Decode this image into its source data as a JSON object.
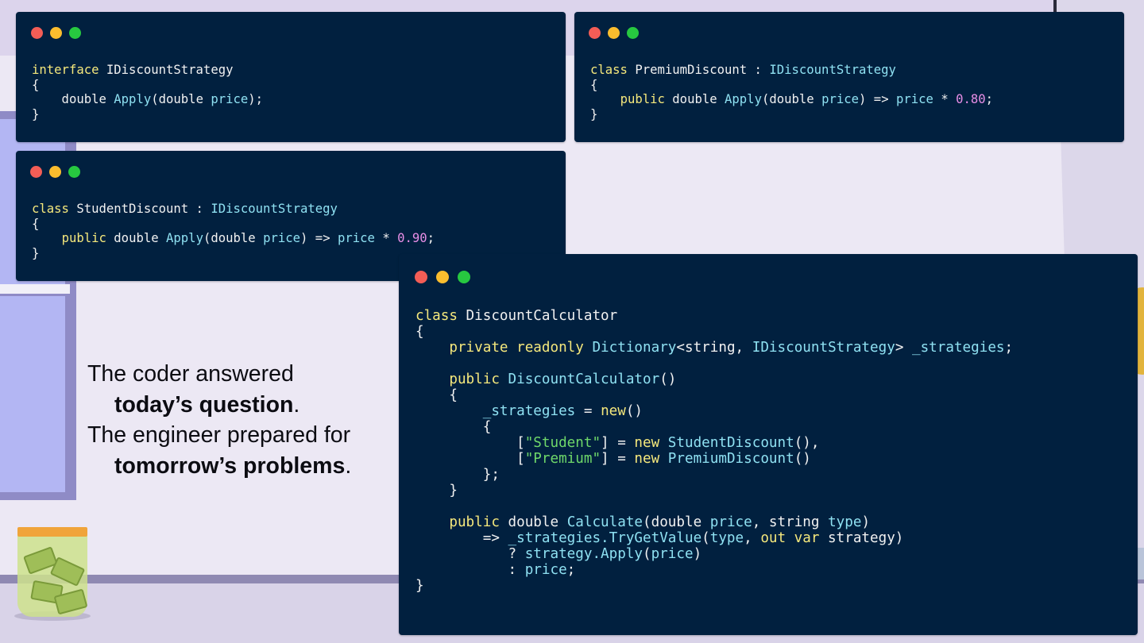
{
  "caption": {
    "line1": "The coder answered",
    "line2_bold": "today’s question",
    "line2_end": ".",
    "line3": "The engineer prepared for",
    "line4_bold": "tomorrow’s problems",
    "line4_end": "."
  },
  "windows": {
    "interface": {
      "lines": [
        [
          {
            "t": "interface",
            "c": "kw"
          },
          {
            "t": " IDiscountStrategy",
            "c": "pl"
          }
        ],
        [
          {
            "t": "{",
            "c": "pl"
          }
        ],
        [
          {
            "t": "    double ",
            "c": "pl"
          },
          {
            "t": "Apply",
            "c": "fn"
          },
          {
            "t": "(double ",
            "c": "pl"
          },
          {
            "t": "price",
            "c": "ty"
          },
          {
            "t": ");",
            "c": "pl"
          }
        ],
        [
          {
            "t": "}",
            "c": "pl"
          }
        ]
      ]
    },
    "premium": {
      "lines": [
        [
          {
            "t": "class",
            "c": "kw"
          },
          {
            "t": " PremiumDiscount : ",
            "c": "pl"
          },
          {
            "t": "IDiscountStrategy",
            "c": "ty"
          }
        ],
        [
          {
            "t": "{",
            "c": "pl"
          }
        ],
        [
          {
            "t": "    ",
            "c": "pl"
          },
          {
            "t": "public",
            "c": "kw"
          },
          {
            "t": " double ",
            "c": "pl"
          },
          {
            "t": "Apply",
            "c": "fn"
          },
          {
            "t": "(double ",
            "c": "pl"
          },
          {
            "t": "price",
            "c": "ty"
          },
          {
            "t": ") => ",
            "c": "pl"
          },
          {
            "t": "price",
            "c": "ty"
          },
          {
            "t": " * ",
            "c": "pl"
          },
          {
            "t": "0.80",
            "c": "num"
          },
          {
            "t": ";",
            "c": "pl"
          }
        ],
        [
          {
            "t": "}",
            "c": "pl"
          }
        ]
      ]
    },
    "student": {
      "lines": [
        [
          {
            "t": "class",
            "c": "kw"
          },
          {
            "t": " StudentDiscount : ",
            "c": "pl"
          },
          {
            "t": "IDiscountStrategy",
            "c": "ty"
          }
        ],
        [
          {
            "t": "{",
            "c": "pl"
          }
        ],
        [
          {
            "t": "    ",
            "c": "pl"
          },
          {
            "t": "public",
            "c": "kw"
          },
          {
            "t": " double ",
            "c": "pl"
          },
          {
            "t": "Apply",
            "c": "fn"
          },
          {
            "t": "(double ",
            "c": "pl"
          },
          {
            "t": "price",
            "c": "ty"
          },
          {
            "t": ") => ",
            "c": "pl"
          },
          {
            "t": "price",
            "c": "ty"
          },
          {
            "t": " * ",
            "c": "pl"
          },
          {
            "t": "0.90",
            "c": "num"
          },
          {
            "t": ";",
            "c": "pl"
          }
        ],
        [
          {
            "t": "}",
            "c": "pl"
          }
        ]
      ]
    },
    "calculator": {
      "lines": [
        [
          {
            "t": "class",
            "c": "kw"
          },
          {
            "t": " DiscountCalculator",
            "c": "pl"
          }
        ],
        [
          {
            "t": "{",
            "c": "pl"
          }
        ],
        [
          {
            "t": "    ",
            "c": "pl"
          },
          {
            "t": "private readonly",
            "c": "kw"
          },
          {
            "t": " ",
            "c": "pl"
          },
          {
            "t": "Dictionary",
            "c": "ty"
          },
          {
            "t": "<string, ",
            "c": "pl"
          },
          {
            "t": "IDiscountStrategy",
            "c": "ty"
          },
          {
            "t": "> ",
            "c": "pl"
          },
          {
            "t": "_strategies",
            "c": "ty"
          },
          {
            "t": ";",
            "c": "pl"
          }
        ],
        [
          {
            "t": "",
            "c": "pl"
          }
        ],
        [
          {
            "t": "    ",
            "c": "pl"
          },
          {
            "t": "public",
            "c": "kw"
          },
          {
            "t": " ",
            "c": "pl"
          },
          {
            "t": "DiscountCalculator",
            "c": "ty"
          },
          {
            "t": "()",
            "c": "pl"
          }
        ],
        [
          {
            "t": "    {",
            "c": "pl"
          }
        ],
        [
          {
            "t": "        ",
            "c": "pl"
          },
          {
            "t": "_strategies",
            "c": "ty"
          },
          {
            "t": " = ",
            "c": "pl"
          },
          {
            "t": "new",
            "c": "kw"
          },
          {
            "t": "()",
            "c": "pl"
          }
        ],
        [
          {
            "t": "        {",
            "c": "pl"
          }
        ],
        [
          {
            "t": "            [",
            "c": "pl"
          },
          {
            "t": "\"Student\"",
            "c": "str"
          },
          {
            "t": "] = ",
            "c": "pl"
          },
          {
            "t": "new",
            "c": "kw"
          },
          {
            "t": " ",
            "c": "pl"
          },
          {
            "t": "StudentDiscount",
            "c": "ty"
          },
          {
            "t": "(),",
            "c": "pl"
          }
        ],
        [
          {
            "t": "            [",
            "c": "pl"
          },
          {
            "t": "\"Premium\"",
            "c": "str"
          },
          {
            "t": "] = ",
            "c": "pl"
          },
          {
            "t": "new",
            "c": "kw"
          },
          {
            "t": " ",
            "c": "pl"
          },
          {
            "t": "PremiumDiscount",
            "c": "ty"
          },
          {
            "t": "()",
            "c": "pl"
          }
        ],
        [
          {
            "t": "        };",
            "c": "pl"
          }
        ],
        [
          {
            "t": "    }",
            "c": "pl"
          }
        ],
        [
          {
            "t": "",
            "c": "pl"
          }
        ],
        [
          {
            "t": "    ",
            "c": "pl"
          },
          {
            "t": "public",
            "c": "kw"
          },
          {
            "t": " double ",
            "c": "pl"
          },
          {
            "t": "Calculate",
            "c": "fn"
          },
          {
            "t": "(double ",
            "c": "pl"
          },
          {
            "t": "price",
            "c": "ty"
          },
          {
            "t": ", string ",
            "c": "pl"
          },
          {
            "t": "type",
            "c": "ty"
          },
          {
            "t": ")",
            "c": "pl"
          }
        ],
        [
          {
            "t": "        => ",
            "c": "pl"
          },
          {
            "t": "_strategies.TryGetValue",
            "c": "ty"
          },
          {
            "t": "(",
            "c": "pl"
          },
          {
            "t": "type",
            "c": "ty"
          },
          {
            "t": ", ",
            "c": "pl"
          },
          {
            "t": "out var",
            "c": "kw"
          },
          {
            "t": " strategy)",
            "c": "pl"
          }
        ],
        [
          {
            "t": "           ? ",
            "c": "pl"
          },
          {
            "t": "strategy.Apply",
            "c": "ty"
          },
          {
            "t": "(",
            "c": "pl"
          },
          {
            "t": "price",
            "c": "ty"
          },
          {
            "t": ")",
            "c": "pl"
          }
        ],
        [
          {
            "t": "           : ",
            "c": "pl"
          },
          {
            "t": "price",
            "c": "ty"
          },
          {
            "t": ";",
            "c": "pl"
          }
        ],
        [
          {
            "t": "}",
            "c": "pl"
          }
        ]
      ]
    }
  }
}
